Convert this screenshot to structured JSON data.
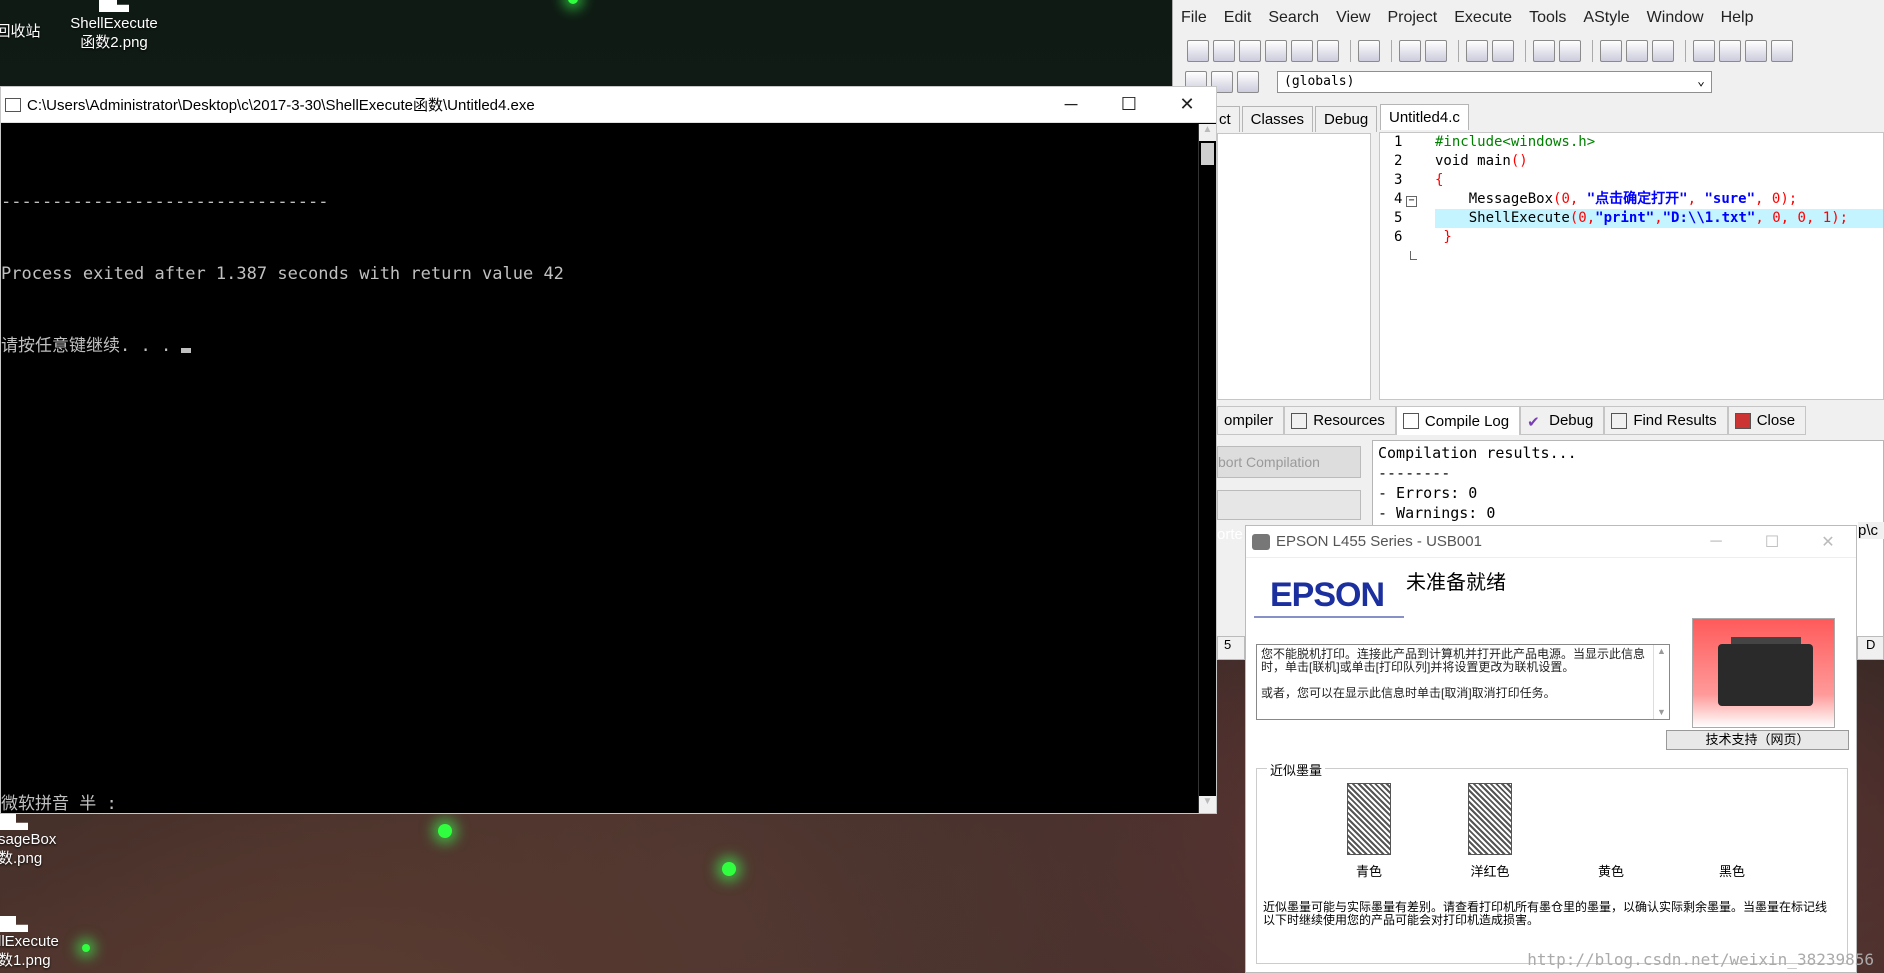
{
  "desktop": {
    "icons": [
      {
        "label1": "回收站",
        "label2": ""
      },
      {
        "label1": "ShellExecute",
        "label2": "函数2.png"
      },
      {
        "label1": "sageBox",
        "label2": "数.png"
      },
      {
        "label1": "llExecute",
        "label2": "数1.png"
      }
    ]
  },
  "console": {
    "title": "C:\\Users\\Administrator\\Desktop\\c\\2017-3-30\\ShellExecute函数\\Untitled4.exe",
    "lines": [
      "--------------------------------",
      "Process exited after 1.387 seconds with return value 42",
      "请按任意键继续. . . "
    ],
    "ime": "微软拼音 半 :"
  },
  "ide": {
    "menu": [
      "File",
      "Edit",
      "Search",
      "View",
      "Project",
      "Execute",
      "Tools",
      "AStyle",
      "Window",
      "Help"
    ],
    "scope_select": "(globals)",
    "left_tabs": [
      "ct",
      "Classes",
      "Debug"
    ],
    "file_tab": "Untitled4.c",
    "line_numbers": [
      "1",
      "2",
      "3",
      "4",
      "5",
      "6"
    ],
    "code": {
      "l1": "#include<windows.h>",
      "l2a": "void main",
      "l2b": "()",
      "l3": "{",
      "l4a": "    MessageBox",
      "l4b": "(",
      "l4c": "0",
      "l4d": ", ",
      "l4e": "\"点击确定打开\"",
      "l4f": ", ",
      "l4g": "\"sure\"",
      "l4h": ", ",
      "l4i": "0",
      "l4j": ");",
      "l5a": "    ShellExecute",
      "l5b": "(",
      "l5c": "0",
      "l5d": ",",
      "l5e": "\"print\"",
      "l5f": ",",
      "l5g": "\"D:\\\\1.txt\"",
      "l5h": ", ",
      "l5i": "0",
      "l5j": ", ",
      "l5k": "0",
      "l5l": ", ",
      "l5m": "1",
      "l5n": ");",
      "l6": " }"
    },
    "bottom_tabs": [
      "ompiler",
      "Resources",
      "Compile Log",
      "Debug",
      "Find Results",
      "Close"
    ],
    "abort_label": "bort Compilation",
    "log": "Compilation results...\n--------\n- Errors: 0\n- Warnings: 0",
    "side_label": "orte",
    "side_label2": "p\\c",
    "row_num": "5",
    "row_d": "D"
  },
  "epson": {
    "title": "EPSON L455 Series - USB001",
    "logo": "EPSON",
    "status": "未准备就绪",
    "message1": "您不能脱机打印。连接此产品到计算机并打开此产品电源。当显示此信息时，单击[联机]或单击[打印队列]并将设置更改为联机设置。",
    "message2": "或者，您可以在显示此信息时单击[取消]取消打印任务。",
    "support_button": "技术支持（网页）",
    "ink_group": "近似墨量",
    "inks": [
      "青色",
      "洋红色",
      "黄色",
      "黑色"
    ],
    "note": "近似墨量可能与实际墨量有差别。请查看打印机所有墨仓里的墨量，以确认实际剩余墨量。当墨量在标记线以下时继续使用您的产品可能会对打印机造成损害。"
  },
  "watermark": "http://blog.csdn.net/weixin_38239856"
}
